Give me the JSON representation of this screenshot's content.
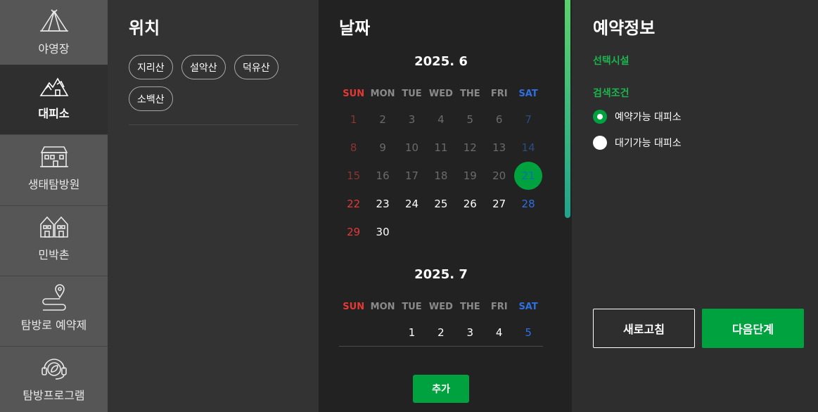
{
  "sidebar": {
    "items": [
      {
        "label": "야영장",
        "icon": "tent-icon",
        "active": false
      },
      {
        "label": "대피소",
        "icon": "mountain-shelter-icon",
        "active": true
      },
      {
        "label": "생태탐방원",
        "icon": "building-icon",
        "active": false
      },
      {
        "label": "민박촌",
        "icon": "houses-icon",
        "active": false
      },
      {
        "label": "탐방로 예약제",
        "icon": "trail-pin-icon",
        "active": false
      },
      {
        "label": "탐방프로그램",
        "icon": "headset-leaf-icon",
        "active": false
      }
    ]
  },
  "location": {
    "title": "위치",
    "chips": [
      "지리산",
      "설악산",
      "덕유산",
      "소백산"
    ]
  },
  "date": {
    "title": "날짜",
    "weekdays": [
      "SUN",
      "MON",
      "TUE",
      "WED",
      "THE",
      "FRI",
      "SAT"
    ],
    "months": [
      {
        "title": "2025. 6",
        "rows": [
          [
            "1",
            "2",
            "3",
            "4",
            "5",
            "6",
            "7"
          ],
          [
            "8",
            "9",
            "10",
            "11",
            "12",
            "13",
            "14"
          ],
          [
            "15",
            "16",
            "17",
            "18",
            "19",
            "20",
            "21"
          ],
          [
            "22",
            "23",
            "24",
            "25",
            "26",
            "27",
            "28"
          ],
          [
            "29",
            "30",
            "",
            "",
            "",
            "",
            ""
          ]
        ],
        "past_until": "20",
        "selected": "21"
      },
      {
        "title": "2025. 7",
        "rows": [
          [
            "",
            "",
            "1",
            "2",
            "3",
            "4",
            "5"
          ]
        ]
      }
    ],
    "add_label": "추가"
  },
  "reservation": {
    "title": "예약정보",
    "facility_label": "선택시설",
    "condition_label": "검색조건",
    "options": [
      {
        "label": "예약가능 대피소",
        "selected": true
      },
      {
        "label": "대기가능 대피소",
        "selected": false
      }
    ],
    "refresh_label": "새로고침",
    "next_label": "다음단계"
  },
  "colors": {
    "accent": "#00a23f",
    "sunday": "#e53935",
    "saturday": "#2f6fe0"
  }
}
